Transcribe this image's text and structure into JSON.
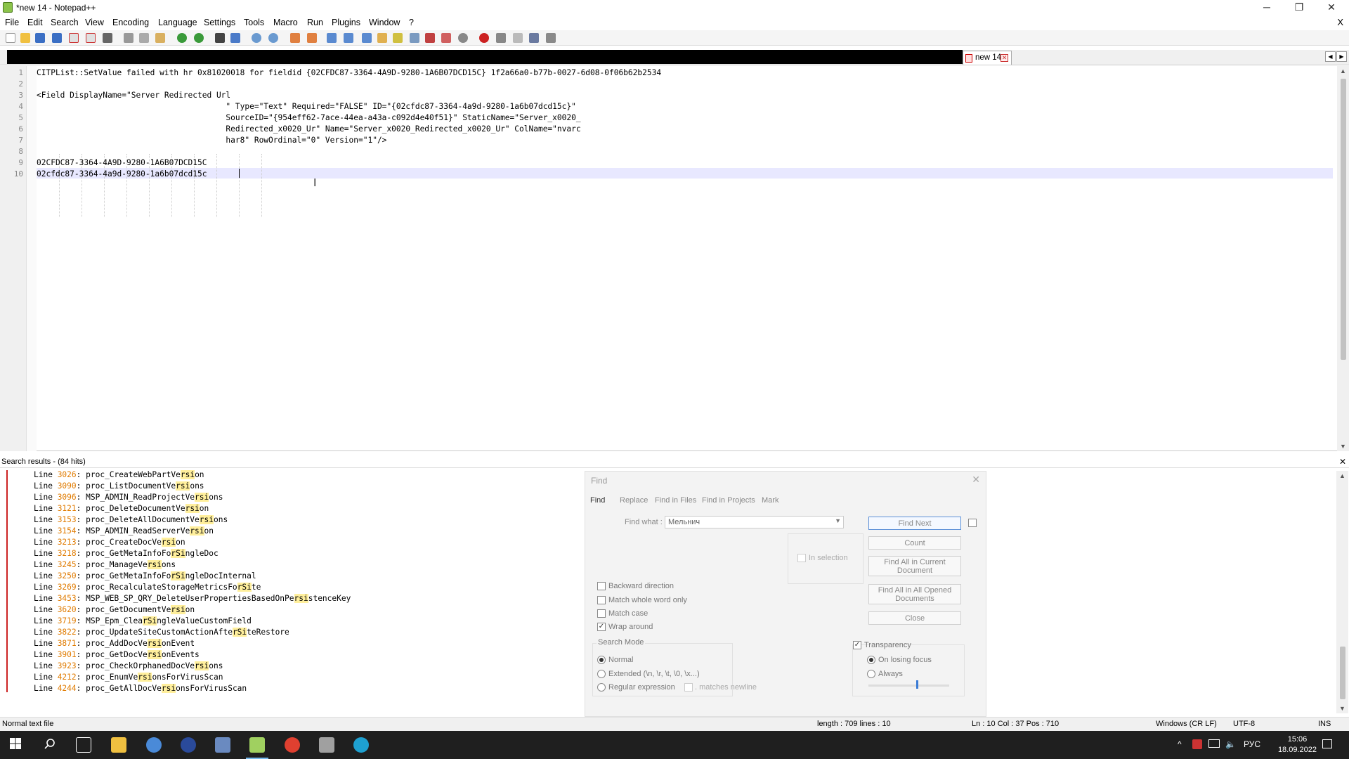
{
  "window": {
    "title": "*new 14 - Notepad++",
    "controls": {
      "minimize": "─",
      "restore": "❐",
      "close": "✕"
    }
  },
  "menu": [
    "File",
    "Edit",
    "Search",
    "View",
    "Encoding",
    "Language",
    "Settings",
    "Tools",
    "Macro",
    "Run",
    "Plugins",
    "Window",
    "?"
  ],
  "menu_close": "X",
  "tabs": [
    {
      "label": "new 14",
      "active": true
    }
  ],
  "editor": {
    "lines": [
      {
        "n": "1",
        "text": "CITPList::SetValue failed with hr 0x81020018 for fieldid {02CFDC87-3364-4A9D-9280-1A6B07DCD15C} 1f2a66a0-b77b-0027-6d08-0f06b62b2534"
      },
      {
        "n": "2",
        "text": ""
      },
      {
        "n": "3",
        "text": "<Field DisplayName=\"Server Redirected Url"
      },
      {
        "n": "4",
        "text": "                                        \" Type=\"Text\" Required=\"FALSE\" ID=\"{02cfdc87-3364-4a9d-9280-1a6b07dcd15c}\""
      },
      {
        "n": "5",
        "text": "                                        SourceID=\"{954eff62-7ace-44ea-a43a-c092d4e40f51}\" StaticName=\"Server_x0020_"
      },
      {
        "n": "6",
        "text": "                                        Redirected_x0020_Ur\" Name=\"Server_x0020_Redirected_x0020_Ur\" ColName=\"nvarc"
      },
      {
        "n": "7",
        "text": "                                        har8\" RowOrdinal=\"0\" Version=\"1\"/>"
      },
      {
        "n": "8",
        "text": ""
      },
      {
        "n": "9",
        "text": "02CFDC87-3364-4A9D-9280-1A6B07DCD15C"
      },
      {
        "n": "10",
        "text": "02cfdc87-3364-4a9d-9280-1a6b07dcd15c"
      }
    ],
    "current_line": 10
  },
  "search_results": {
    "header": "Search results - (84 hits)",
    "close": "✕",
    "items": [
      {
        "num": "3026",
        "pre": "proc_CreateWebPartVe",
        "hl": "rsi",
        "post": "on"
      },
      {
        "num": "3090",
        "pre": "proc_ListDocumentVe",
        "hl": "rsi",
        "post": "ons"
      },
      {
        "num": "3096",
        "pre": "MSP_ADMIN_ReadProjectVe",
        "hl": "rsi",
        "post": "ons"
      },
      {
        "num": "3121",
        "pre": "proc_DeleteDocumentVe",
        "hl": "rsi",
        "post": "on"
      },
      {
        "num": "3153",
        "pre": "proc_DeleteAllDocumentVe",
        "hl": "rsi",
        "post": "ons"
      },
      {
        "num": "3154",
        "pre": "MSP_ADMIN_ReadServerVe",
        "hl": "rsi",
        "post": "on"
      },
      {
        "num": "3213",
        "pre": "proc_CreateDocVe",
        "hl": "rsi",
        "post": "on"
      },
      {
        "num": "3218",
        "pre": "proc_GetMetaInfoFo",
        "hl": "rSi",
        "post": "ngleDoc"
      },
      {
        "num": "3245",
        "pre": "proc_ManageVe",
        "hl": "rsi",
        "post": "ons"
      },
      {
        "num": "3250",
        "pre": "proc_GetMetaInfoFo",
        "hl": "rSi",
        "post": "ngleDocInternal"
      },
      {
        "num": "3269",
        "pre": "proc_RecalculateStorageMetricsFo",
        "hl": "rSi",
        "post": "te"
      },
      {
        "num": "3453",
        "pre": "MSP_WEB_SP_QRY_DeleteUserPropertiesBasedOnPe",
        "hl": "rsi",
        "post": "stenceKey"
      },
      {
        "num": "3620",
        "pre": "proc_GetDocumentVe",
        "hl": "rsi",
        "post": "on"
      },
      {
        "num": "3719",
        "pre": "MSP_Epm_Clea",
        "hl": "rSi",
        "post": "ngleValueCustomField"
      },
      {
        "num": "3822",
        "pre": "proc_UpdateSiteCustomActionAfte",
        "hl": "rSi",
        "post": "teRestore"
      },
      {
        "num": "3871",
        "pre": "proc_AddDocVe",
        "hl": "rsi",
        "post": "onEvent"
      },
      {
        "num": "3901",
        "pre": "proc_GetDocVe",
        "hl": "rsi",
        "post": "onEvents"
      },
      {
        "num": "3923",
        "pre": "proc_CheckOrphanedDocVe",
        "hl": "rsi",
        "post": "ons"
      },
      {
        "num": "4212",
        "pre": "proc_EnumVe",
        "hl": "rsi",
        "post": "onsForVirusScan"
      },
      {
        "num": "4244",
        "pre": "proc_GetAllDocVe",
        "hl": "rsi",
        "post": "onsForVirusScan"
      }
    ],
    "line_word": "Line "
  },
  "find_dialog": {
    "title": "Find",
    "close": "✕",
    "tabs": [
      "Find",
      "Replace",
      "Find in Files",
      "Find in Projects",
      "Mark"
    ],
    "find_what_label": "Find what :",
    "find_what_value": "Мельнич",
    "buttons": {
      "find_next": "Find Next",
      "count": "Count",
      "find_all_current": "Find All in Current Document",
      "find_all_opened": "Find All in All Opened Documents",
      "close": "Close"
    },
    "in_selection": "In selection",
    "options": [
      {
        "label": "Backward direction",
        "checked": false
      },
      {
        "label": "Match whole word only",
        "checked": false
      },
      {
        "label": "Match case",
        "checked": false
      },
      {
        "label": "Wrap around",
        "checked": true
      }
    ],
    "search_mode_label": "Search Mode",
    "modes": [
      {
        "label": "Normal",
        "selected": true
      },
      {
        "label": "Extended (\\n, \\r, \\t, \\0, \\x...)",
        "selected": false
      },
      {
        "label": "Regular expression",
        "selected": false
      }
    ],
    "matches_newline": ". matches newline",
    "transparency": {
      "label": "Transparency",
      "checked": true
    },
    "transparency_modes": [
      {
        "label": "On losing focus",
        "selected": true
      },
      {
        "label": "Always",
        "selected": false
      }
    ],
    "transparency_level": 0.6
  },
  "status": {
    "file_type": "Normal text file",
    "length": "length : 709    lines : 10",
    "position": "Ln : 10    Col : 37    Pos : 710",
    "eol": "Windows (CR LF)",
    "encoding": "UTF-8",
    "mode": "INS"
  },
  "taskbar": {
    "tray_lang": "РУС",
    "time": "15:06",
    "date": "18.09.2022",
    "chevron": "^"
  },
  "colors": {
    "result_number": "#e07b00",
    "result_highlight": "#ffef9c",
    "current_line": "#e8e8ff",
    "taskbar": "#1f1f1f"
  }
}
